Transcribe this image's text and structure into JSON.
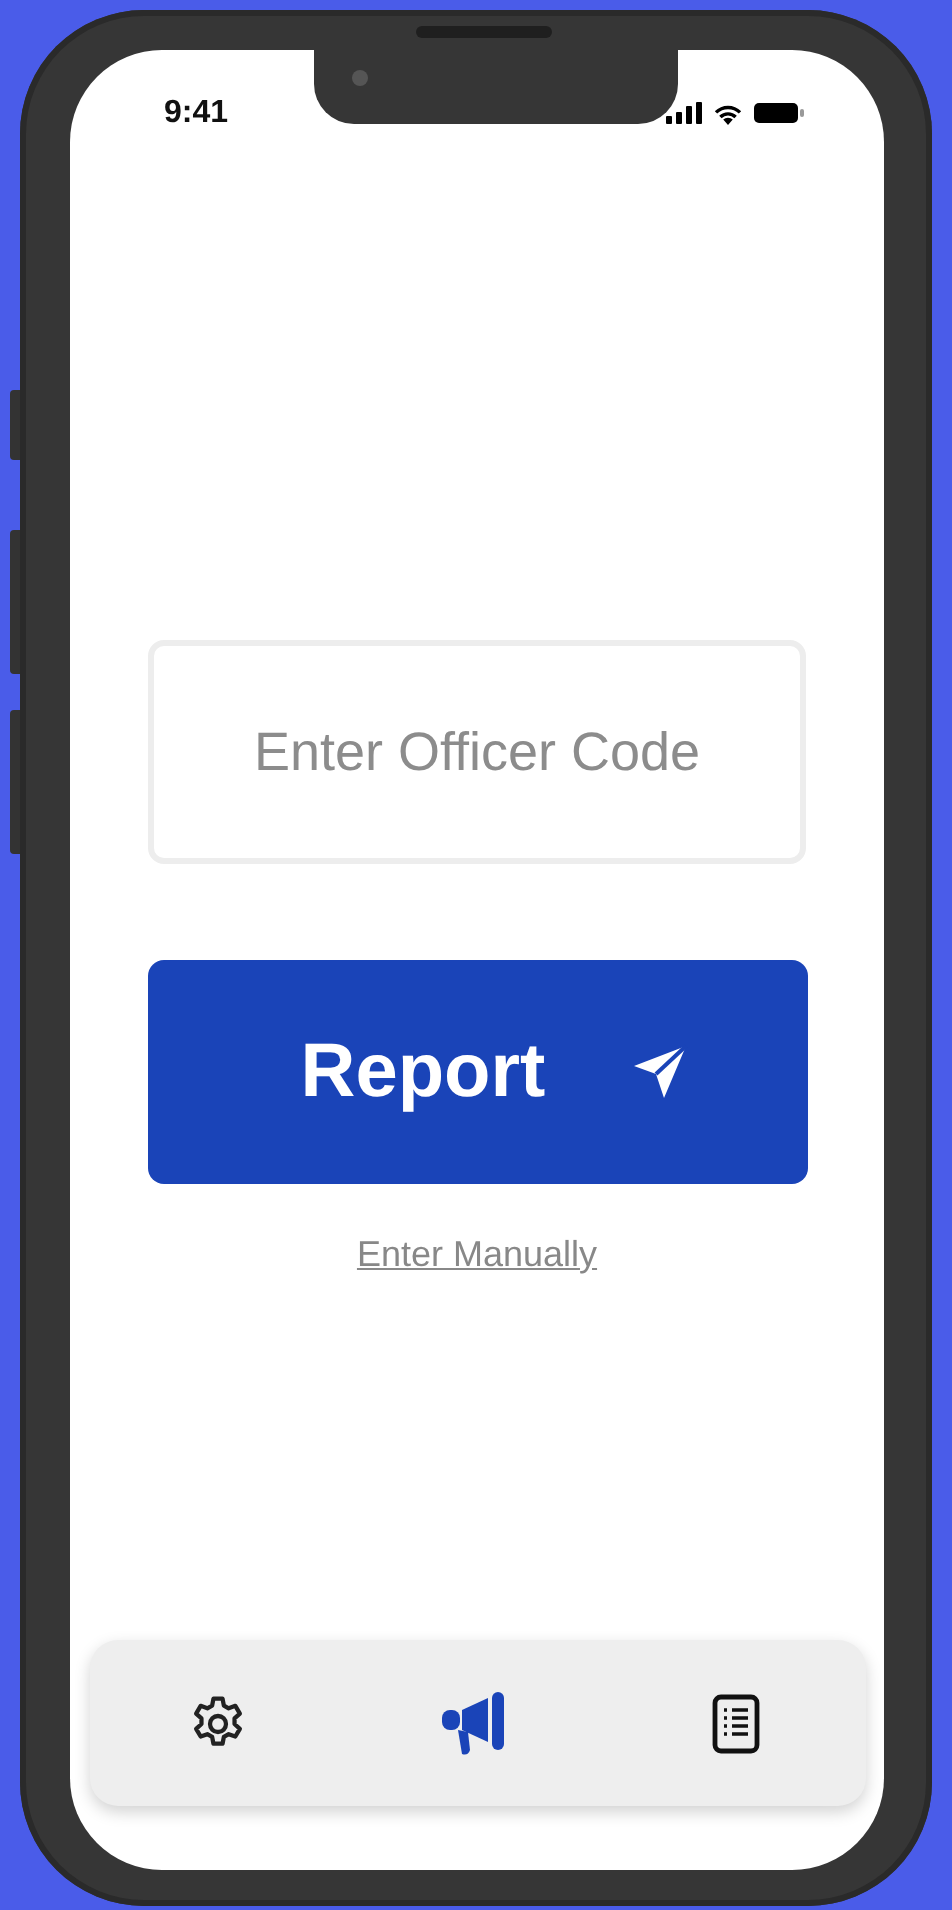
{
  "status_bar": {
    "time": "9:41"
  },
  "officer_code_field": {
    "placeholder": "Enter Officer Code"
  },
  "report_button": {
    "label": "Report"
  },
  "manual_link": {
    "label": "Enter Manually"
  },
  "nav_items": [
    {
      "kind": "settings",
      "selected": false
    },
    {
      "kind": "report",
      "selected": true
    },
    {
      "kind": "log",
      "selected": false
    }
  ]
}
